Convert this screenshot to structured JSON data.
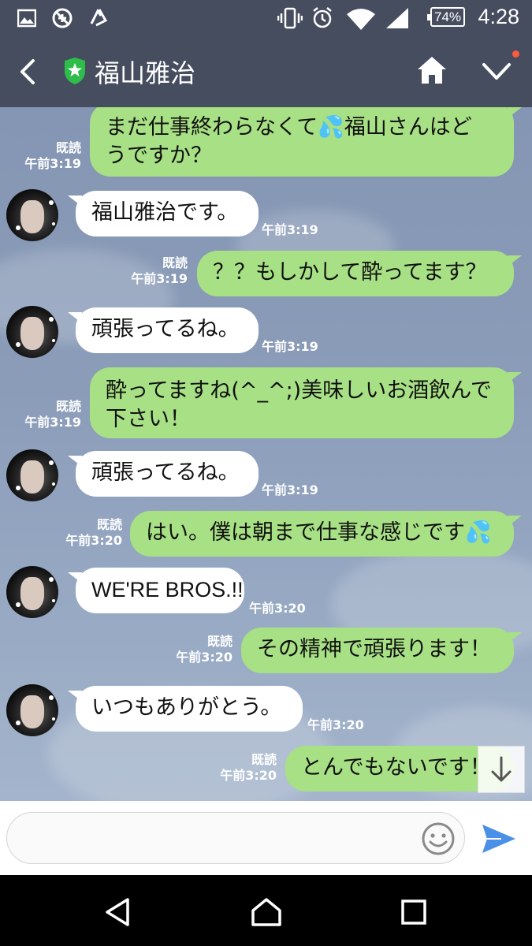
{
  "status_bar": {
    "time": "4:28",
    "battery": "74%",
    "icons": [
      "image-icon",
      "blocked-icon",
      "recycle-icon",
      "vibrate-icon",
      "alarm-icon",
      "wifi-icon",
      "signal-icon"
    ]
  },
  "header": {
    "title": "福山雅治",
    "icons": [
      "back-icon",
      "official-shield-icon",
      "home-icon",
      "chevron-down-icon"
    ],
    "colors": {
      "bg": "#454d5f",
      "shield": "#2ebd4b",
      "notify_dot": "#ff5a3c"
    }
  },
  "messages": [
    {
      "side": "out",
      "lines": [
        "まだ仕事終わらなくて💦福山さんはど",
        "うですか？"
      ],
      "read": "既読",
      "time": "午前3:19"
    },
    {
      "side": "in",
      "text": "福山雅治です。",
      "time": "午前3:19"
    },
    {
      "side": "out",
      "text": "？？もしかして酔ってます？",
      "read": "既読",
      "time": "午前3:19"
    },
    {
      "side": "in",
      "text": "頑張ってるね。",
      "time": "午前3:19"
    },
    {
      "side": "out",
      "lines": [
        "酔ってますね(^_^;)美味しいお酒飲んで",
        "下さい！"
      ],
      "read": "既読",
      "time": "午前3:19"
    },
    {
      "side": "in",
      "text": "頑張ってるね。",
      "time": "午前3:19"
    },
    {
      "side": "out",
      "text": "はい。僕は朝まで仕事な感じです💦",
      "read": "既読",
      "time": "午前3:20"
    },
    {
      "side": "in",
      "text": "WE'RE BROS.!!",
      "time": "午前3:20"
    },
    {
      "side": "out",
      "text": "その精神で頑張ります！",
      "read": "既読",
      "time": "午前3:20"
    },
    {
      "side": "in",
      "text": "いつもありがとう。",
      "time": "午前3:20"
    },
    {
      "side": "out",
      "text": "とんでもないです！",
      "read": "既読",
      "time": "午前3:20"
    }
  ],
  "input": {
    "placeholder": "",
    "icons": [
      "emoji-icon",
      "send-icon"
    ]
  },
  "nav_bar": {
    "icons": [
      "nav-back-icon",
      "nav-home-icon",
      "nav-recents-icon"
    ]
  },
  "colors": {
    "outgoing_bubble": "#a8e085",
    "incoming_bubble": "#ffffff",
    "send": "#4a8fe8"
  }
}
